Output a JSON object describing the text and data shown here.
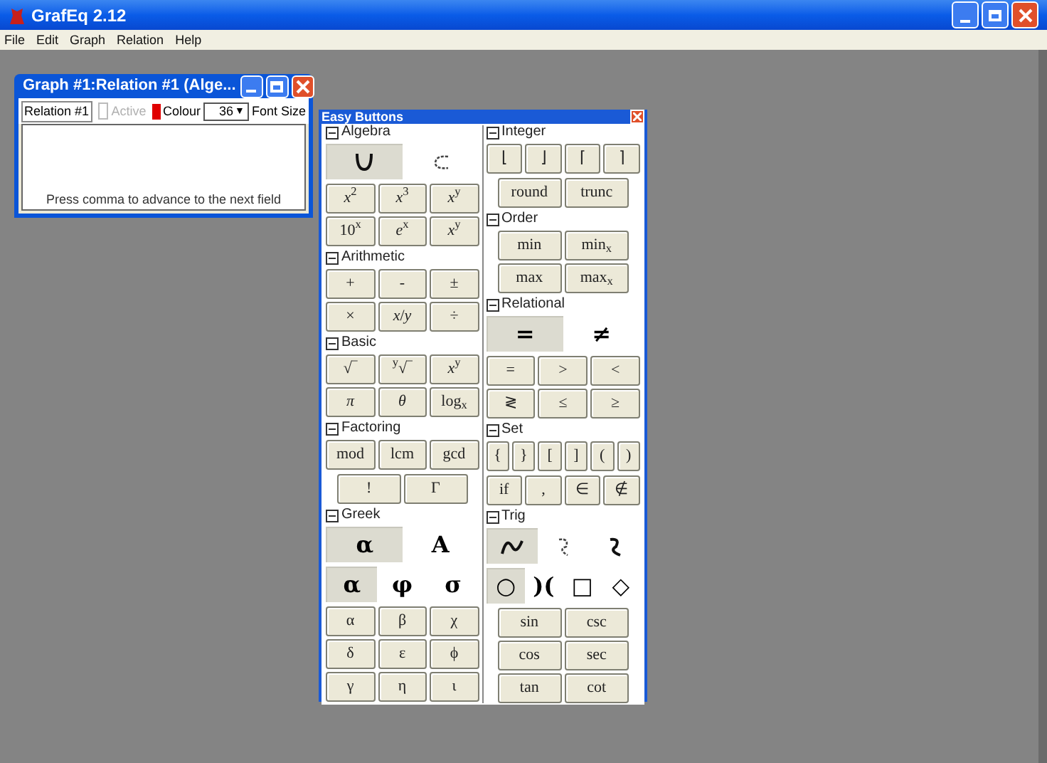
{
  "app": {
    "title": "GrafEq 2.12",
    "menu": [
      "File",
      "Edit",
      "Graph",
      "Relation",
      "Help"
    ]
  },
  "graph_window": {
    "title": "Graph #1:Relation #1 (Alge...",
    "relation_name": "Relation #1",
    "active": {
      "label": "Active",
      "checked": false,
      "disabled": true
    },
    "colour": {
      "label": "Colour",
      "color": "#e00000"
    },
    "font_size": {
      "value": "36",
      "arrow": "▼",
      "label": "Font Size"
    },
    "hint": "Press comma to advance to the next field"
  },
  "easy_buttons": {
    "title": "Easy Buttons",
    "columns": [
      [
        {
          "title": "Algebra",
          "expanded": true,
          "groups": [
            {
              "kind": "toggles2",
              "items": [
                {
                  "kind": "cup-curve",
                  "selected": true
                },
                {
                  "kind": "dashed-arc",
                  "selected": false
                }
              ]
            },
            {
              "kind": "grid3",
              "items": [
                "*x*$^{2}$",
                "*x*$^{3}$",
                "*x*$^{y}$",
                "10$^{x}$",
                "*e*$^{x}$",
                "*x*$^{y}$"
              ]
            }
          ]
        },
        {
          "title": "Arithmetic",
          "expanded": true,
          "groups": [
            {
              "kind": "grid3",
              "items": [
                "+",
                "-",
                "±",
                "×",
                "*x*/*y*",
                "÷"
              ]
            }
          ]
        },
        {
          "title": "Basic",
          "expanded": true,
          "groups": [
            {
              "kind": "grid3",
              "items": [
                "√‾",
                "$^{y}$√‾",
                "*x*$^{y}$",
                "*π*",
                "*θ*",
                "log$_{x}$"
              ]
            }
          ]
        },
        {
          "title": "Factoring",
          "expanded": true,
          "groups": [
            {
              "kind": "grid3",
              "items": [
                "mod",
                "lcm",
                "gcd"
              ]
            },
            {
              "kind": "grid2",
              "items": [
                "!",
                "Γ"
              ]
            }
          ]
        },
        {
          "title": "Greek",
          "expanded": true,
          "groups": [
            {
              "kind": "toggles2",
              "items": [
                {
                  "kind": "text",
                  "label": "α",
                  "selected": true
                },
                {
                  "kind": "text",
                  "label": "A",
                  "selected": false
                }
              ]
            },
            {
              "kind": "toggles3",
              "items": [
                {
                  "kind": "text",
                  "label": "α",
                  "selected": true
                },
                {
                  "kind": "text",
                  "label": "φ",
                  "selected": false
                },
                {
                  "kind": "text",
                  "label": "σ",
                  "selected": false
                }
              ]
            },
            {
              "kind": "grid3",
              "items": [
                "α",
                "β",
                "χ",
                "δ",
                "ε",
                "ϕ",
                "γ",
                "η",
                "ι"
              ]
            }
          ]
        }
      ],
      [
        {
          "title": "Integer",
          "expanded": true,
          "groups": [
            {
              "kind": "grid4",
              "items": [
                "⌊",
                "⌋",
                "⌈",
                "⌉"
              ]
            },
            {
              "kind": "grid2",
              "items": [
                "round",
                "trunc"
              ]
            }
          ]
        },
        {
          "title": "Order",
          "expanded": true,
          "groups": [
            {
              "kind": "grid2",
              "items": [
                "min",
                "min$_{x}$",
                "max",
                "max$_{x}$"
              ]
            }
          ]
        },
        {
          "title": "Relational",
          "expanded": true,
          "groups": [
            {
              "kind": "toggles2",
              "items": [
                {
                  "kind": "text",
                  "label": "=",
                  "selected": true
                },
                {
                  "kind": "text",
                  "label": "≠",
                  "selected": false
                }
              ]
            },
            {
              "kind": "grid3",
              "items": [
                "=",
                ">",
                "<",
                "≷",
                "≤",
                "≥"
              ]
            }
          ]
        },
        {
          "title": "Set",
          "expanded": true,
          "groups": [
            {
              "kind": "grid6",
              "items": [
                "{",
                "}",
                "[",
                "]",
                "(",
                ")"
              ]
            },
            {
              "kind": "grid4",
              "items": [
                "if",
                ",",
                "∈",
                "∉"
              ]
            }
          ]
        },
        {
          "title": "Trig",
          "expanded": true,
          "groups": [
            {
              "kind": "toggles3",
              "items": [
                {
                  "kind": "wave",
                  "selected": true
                },
                {
                  "kind": "dashed-s",
                  "selected": false
                },
                {
                  "kind": "s-curve",
                  "selected": false
                }
              ]
            },
            {
              "kind": "toggles4",
              "items": [
                {
                  "kind": "text",
                  "label": "○",
                  "selected": true
                },
                {
                  "kind": "text",
                  "label": ")(",
                  "selected": false
                },
                {
                  "kind": "text",
                  "label": "□",
                  "selected": false
                },
                {
                  "kind": "text",
                  "label": "◇",
                  "selected": false
                }
              ]
            },
            {
              "kind": "grid2",
              "items": [
                "sin",
                "csc",
                "cos",
                "sec",
                "tan",
                "cot"
              ]
            }
          ]
        }
      ]
    ]
  }
}
